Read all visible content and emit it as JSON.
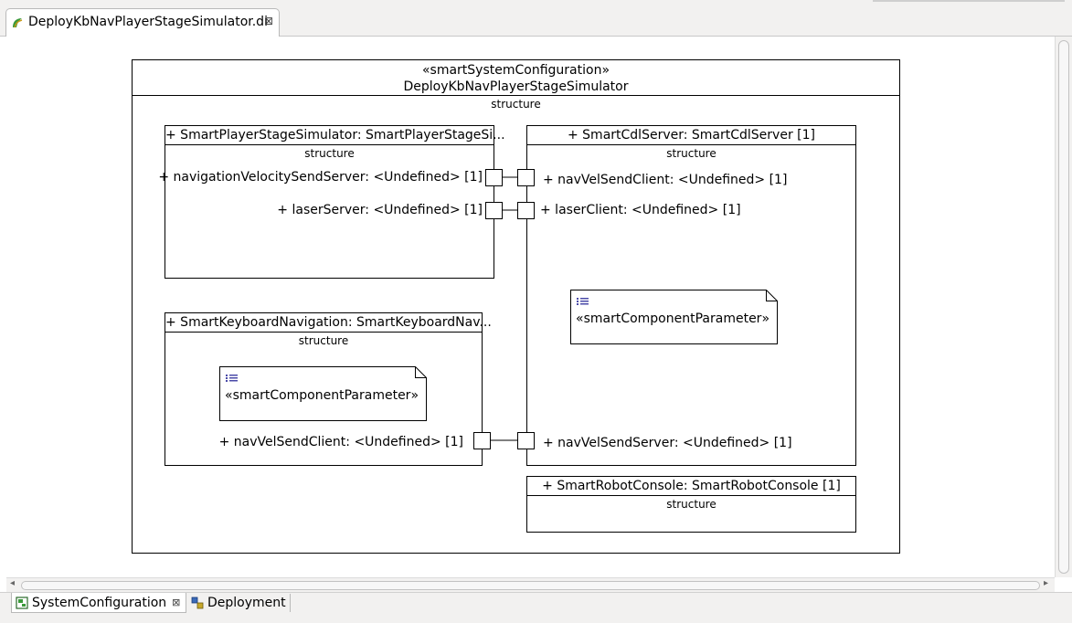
{
  "editor_tab": {
    "label": "DeployKbNavPlayerStageSimulator.di",
    "close": "⊠"
  },
  "system": {
    "stereotype": "«smartSystemConfiguration»",
    "name": "DeployKbNavPlayerStageSimulator",
    "compartment": "structure"
  },
  "parts": {
    "player_stage": {
      "title": "+ SmartPlayerStageSimulator: SmartPlayerStageSi...",
      "compartment": "structure",
      "ports": [
        "+ navigationVelocitySendServer: <Undefined> [1]",
        "+ laserServer: <Undefined> [1]"
      ]
    },
    "cdl_server": {
      "title": "+ SmartCdlServer: SmartCdlServer [1]",
      "compartment": "structure",
      "ports": [
        "+ navVelSendClient: <Undefined> [1]",
        "+ laserClient: <Undefined> [1]",
        "+ navVelSendServer: <Undefined> [1]"
      ],
      "note": "«smartComponentParameter»"
    },
    "keyboard_nav": {
      "title": "+ SmartKeyboardNavigation: SmartKeyboardNav...",
      "compartment": "structure",
      "ports": [
        "+ navVelSendClient: <Undefined> [1]"
      ],
      "note": "«smartComponentParameter»"
    },
    "robot_console": {
      "title": "+ SmartRobotConsole: SmartRobotConsole [1]",
      "compartment": "structure"
    }
  },
  "bottom_tabs": [
    {
      "label": "SystemConfiguration",
      "close": "⊠"
    },
    {
      "label": "Deployment"
    }
  ],
  "colors": {
    "tab_bg": "#f2f1f0",
    "icon_green": "#3a9a3a",
    "note_icon": "#4a4aa8"
  }
}
